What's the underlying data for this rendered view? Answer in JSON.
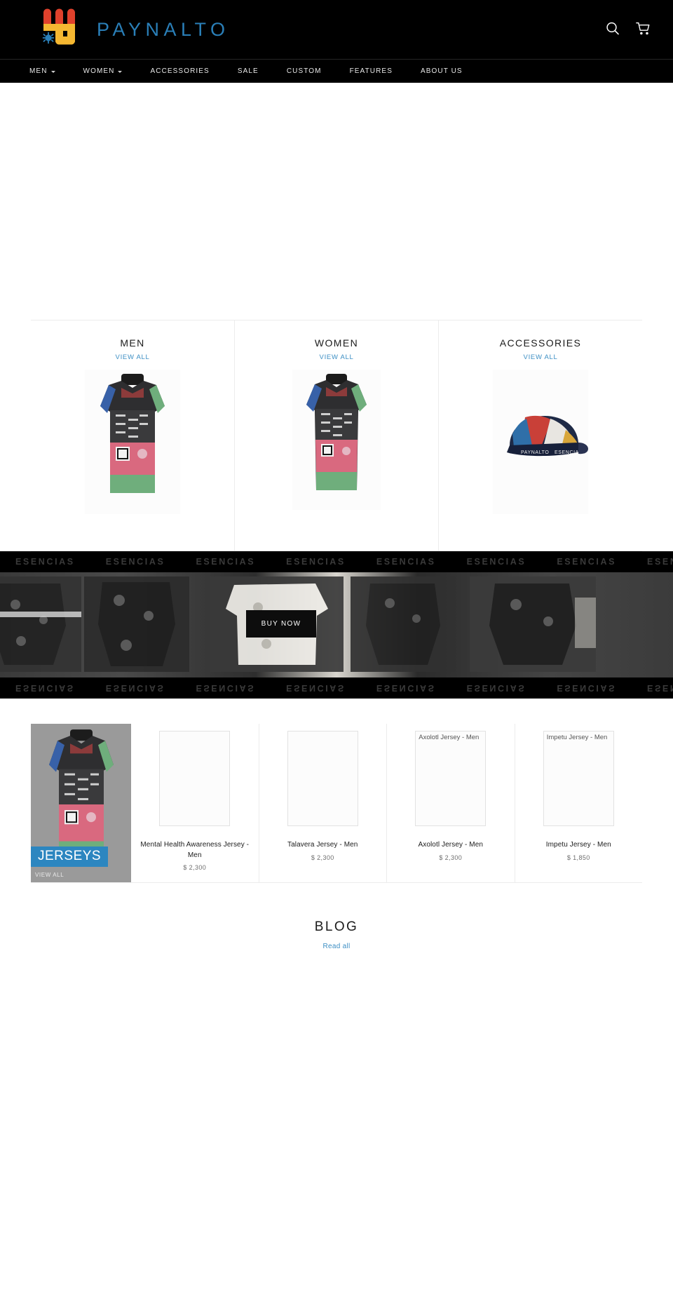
{
  "header": {
    "brand_name": "PAYNALTO",
    "brand_color": "#2a7fb8",
    "logo_red": "#e0412c",
    "logo_yellow": "#f5b731",
    "logo_blue": "#2a7fb8",
    "search_icon": "search-icon",
    "cart_icon": "shopping-cart-icon"
  },
  "nav": {
    "items": [
      {
        "label": "MEN",
        "has_dropdown": true
      },
      {
        "label": "WOMEN",
        "has_dropdown": true
      },
      {
        "label": "ACCESSORIES",
        "has_dropdown": false
      },
      {
        "label": "SALE",
        "has_dropdown": false
      },
      {
        "label": "CUSTOM",
        "has_dropdown": false
      },
      {
        "label": "FEATURES",
        "has_dropdown": false
      },
      {
        "label": "ABOUT US",
        "has_dropdown": false
      }
    ]
  },
  "categories": {
    "view_all_label": "VIEW ALL",
    "link_color": "#3d8fc4",
    "cards": [
      {
        "title": "MEN",
        "image_alt": "mens-cycling-jersey"
      },
      {
        "title": "WOMEN",
        "image_alt": "womens-cycling-jersey"
      },
      {
        "title": "ACCESSORIES",
        "image_alt": "cycling-cap"
      }
    ]
  },
  "marquee": {
    "word": "ESENCIAS",
    "repeat_count": 10,
    "text_color": "#3a3a3a",
    "background": "#000000"
  },
  "promo": {
    "buy_now_label": "BUY NOW",
    "image_alt": "esencias-bib-shorts-and-jersey-collection"
  },
  "products": {
    "feature": {
      "badge_label": "JERSEYS",
      "view_all_label": "VIEW ALL",
      "badge_color": "#2c86c0",
      "image_alt": "featured-jersey"
    },
    "items": [
      {
        "name": "Mental Health Awareness Jersey - Men",
        "price": "$ 2,300",
        "thumb_alt": ""
      },
      {
        "name": "Talavera Jersey - Men",
        "price": "$ 2,300",
        "thumb_alt": ""
      },
      {
        "name": "Axolotl Jersey - Men",
        "price": "$ 2,300",
        "thumb_alt": "Axolotl Jersey - Men"
      },
      {
        "name": "Impetu Jersey - Men",
        "price": "$ 1,850",
        "thumb_alt": "Impetu Jersey - Men"
      }
    ]
  },
  "blog": {
    "title": "BLOG",
    "read_all_label": "Read all",
    "link_color": "#3d8fc4"
  }
}
